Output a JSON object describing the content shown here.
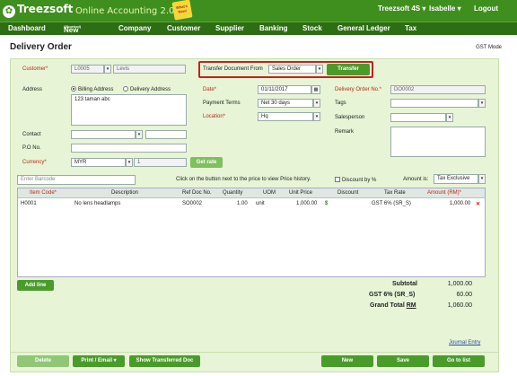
{
  "app": {
    "brand": "Treezsoft",
    "product": "Online Accounting 2.0",
    "badge": "What's New!",
    "company": "Treezsoft 4S",
    "user": "Isabelle",
    "logout": "Logout"
  },
  "nav": [
    "Dashboard",
    "New",
    "(Shortcut)",
    "Company",
    "Customer",
    "Supplier",
    "Banking",
    "Stock",
    "General Ledger",
    "Tax"
  ],
  "page": {
    "title": "Delivery Order",
    "mode": "GST Mode"
  },
  "form": {
    "customer_label": "Customer*",
    "customer_code": "L0005",
    "customer_name": "Levis",
    "transfer_label": "Transfer Document From",
    "transfer_value": "Sales Order",
    "transfer_button": "Transfer",
    "address_label": "Address",
    "billing_radio": "Billing Address",
    "delivery_radio": "Delivery Address",
    "address_value": "123 taman abc",
    "date_label": "Date*",
    "date_value": "01/11/2017",
    "terms_label": "Payment Terms",
    "terms_value": "Net 30 days",
    "location_label": "Location*",
    "location_value": "Hq",
    "do_no_label": "Delivery Order No.*",
    "do_no_value": "DO0002",
    "tags_label": "Tags",
    "salesperson_label": "Salesperson",
    "remark_label": "Remark",
    "contact_label": "Contact",
    "po_label": "P.O No.",
    "currency_label": "Currency*",
    "currency_value": "MYR",
    "rate_value": "1",
    "get_rate": "Get rate",
    "barcode_placeholder": "Enter Barcode",
    "price_hint": "Click on the button next to the price to view Price history.",
    "discount_pct": "Discount by %",
    "amount_is_label": "Amount is:",
    "amount_is_value": "Tax Exclusive"
  },
  "table": {
    "headers": [
      "Item Code*",
      "Description",
      "Ref Doc No.",
      "Quantity",
      "UOM",
      "Unit Price",
      "Discount",
      "Tax Rate",
      "Amount (RM)*"
    ],
    "rows": [
      {
        "item": "H0001",
        "desc": "No lens headlamps",
        "ref": "SO0002",
        "qty": "1.00",
        "uom": "unit",
        "price": "1,000.00",
        "discount": "",
        "tax": "GST 6% (SR_S)",
        "amount": "1,000.00"
      }
    ]
  },
  "add_line": "Add line",
  "totals": {
    "subtotal_label": "Subtotal",
    "subtotal": "1,000.00",
    "gst_label": "GST 6% (SR_S)",
    "gst": "60.00",
    "grand_label": "Grand Total",
    "grand_currency": "RM",
    "grand": "1,060.00"
  },
  "journal_entry": "Journal Entry",
  "footer": {
    "delete": "Delete",
    "print": "Print / Email",
    "show": "Show Transferred Doc",
    "new": "New",
    "save": "Save",
    "goto": "Go to list"
  },
  "colors": {
    "brand_green": "#3f8f1f",
    "nav_green": "#2d6e14",
    "panel": "#e7f4d6",
    "highlight": "#c91f1f"
  }
}
